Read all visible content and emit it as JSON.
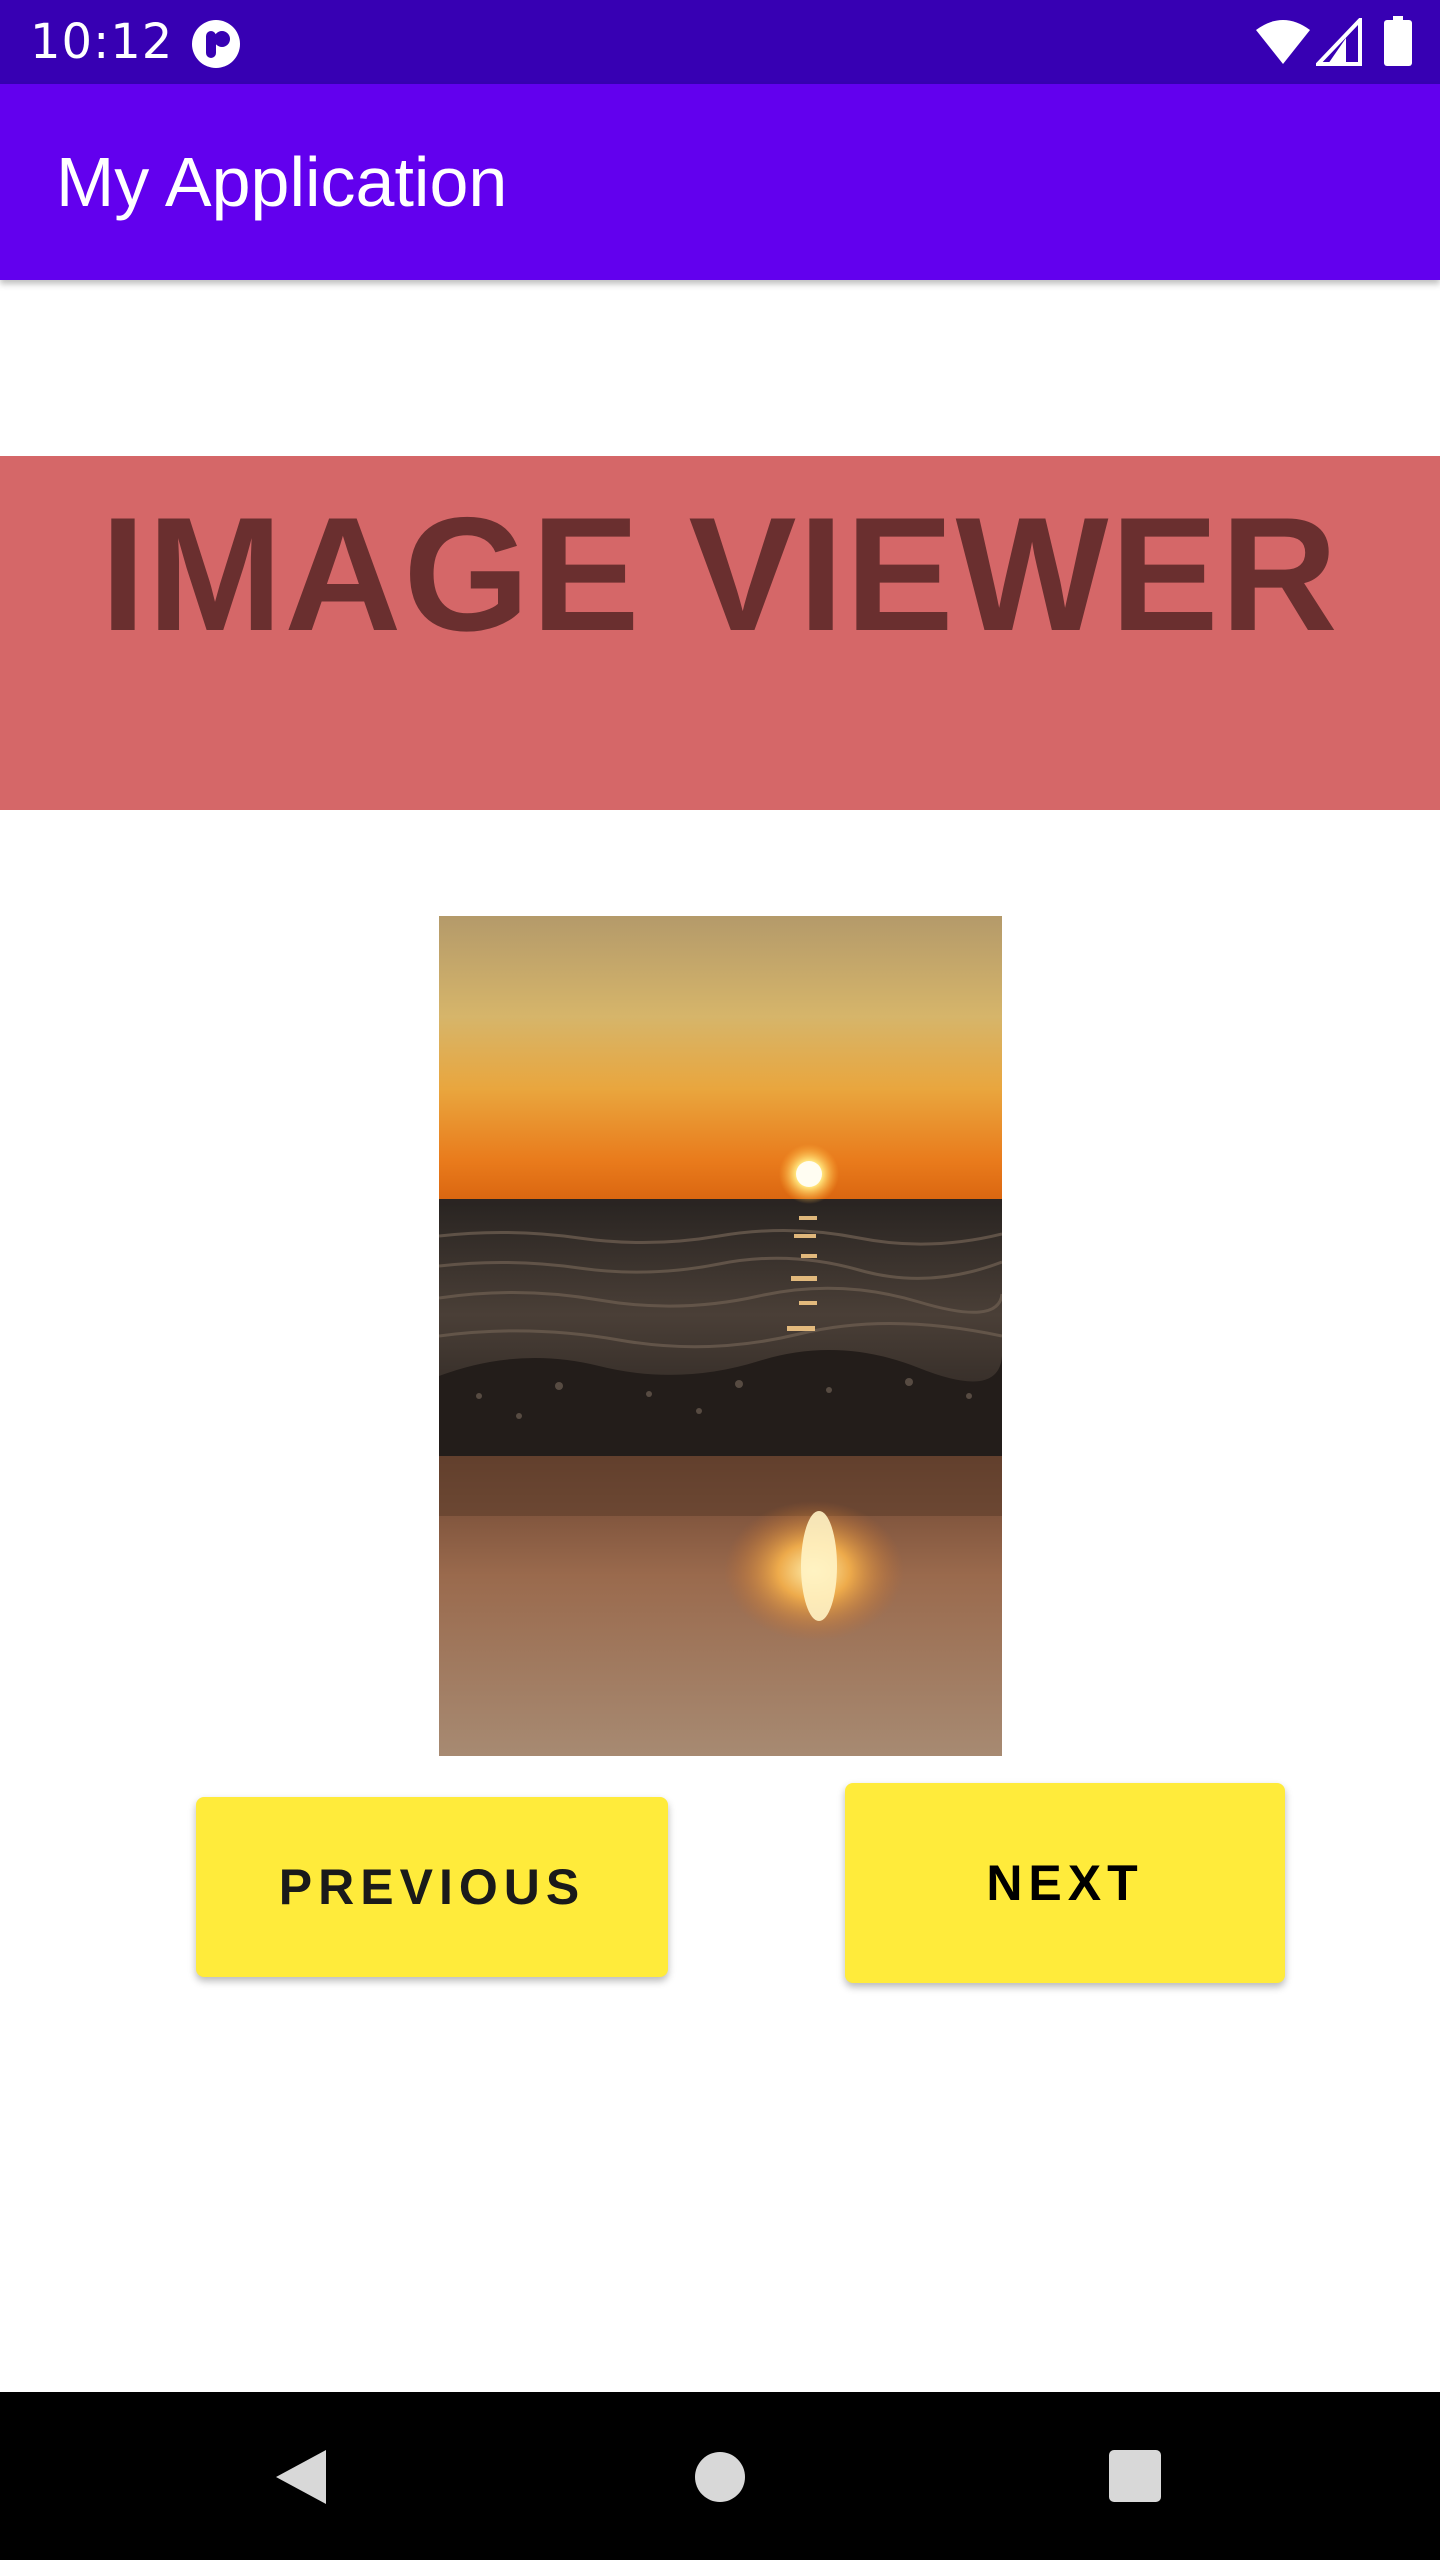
{
  "status_bar": {
    "time": "10:12",
    "icons": [
      "app-notification-icon",
      "wifi-icon",
      "cell-signal-icon",
      "battery-icon"
    ],
    "colors": {
      "background": "#3700b3",
      "foreground": "#ffffff"
    }
  },
  "app_bar": {
    "title": "My Application",
    "colors": {
      "background": "#6200ee",
      "foreground": "#ffffff"
    }
  },
  "banner": {
    "title": "IMAGE VIEWER",
    "colors": {
      "background": "#d56768",
      "text": "#6a2f2f"
    }
  },
  "image": {
    "subject": "sunset over sea waves on beach",
    "alt": "sunset over sea waves on beach"
  },
  "buttons": {
    "previous_label": "PREVIOUS",
    "next_label": "NEXT",
    "colors": {
      "background": "#ffeb3b",
      "text": "#1a1a1a"
    }
  },
  "nav_bar": {
    "icons": [
      "back-icon",
      "home-icon",
      "recents-icon"
    ],
    "colors": {
      "background": "#000000",
      "foreground": "#d8d8d8"
    }
  }
}
